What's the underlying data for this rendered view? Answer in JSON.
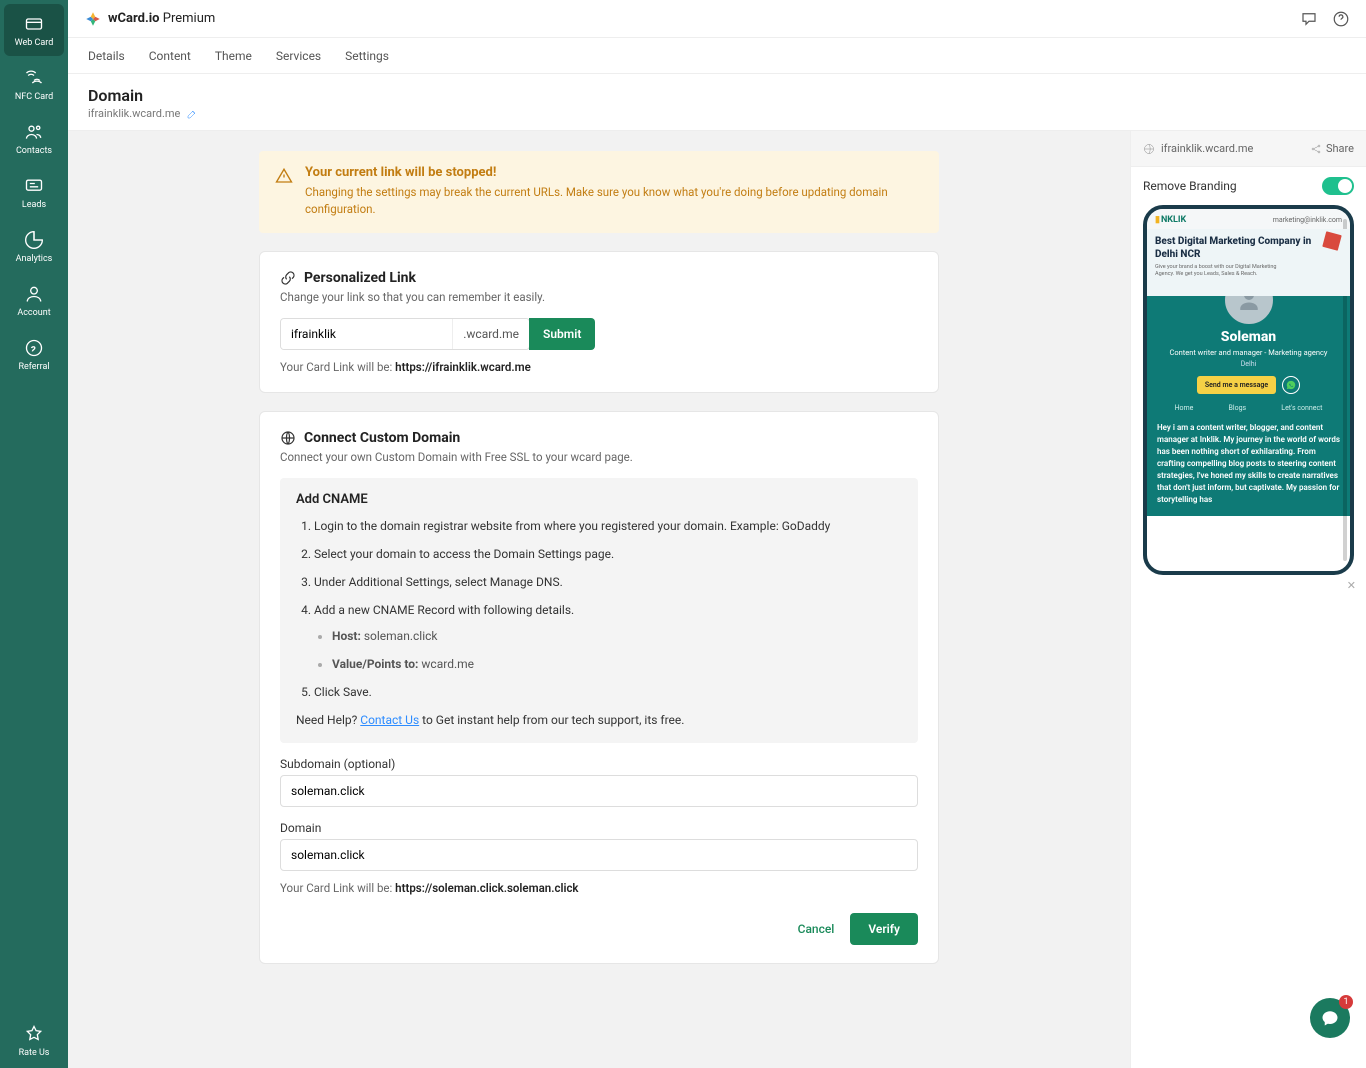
{
  "brand": {
    "name": "wCard.io",
    "tier": "Premium"
  },
  "sidebar": {
    "items": [
      {
        "label": "Web Card"
      },
      {
        "label": "NFC Card"
      },
      {
        "label": "Contacts"
      },
      {
        "label": "Leads"
      },
      {
        "label": "Analytics"
      },
      {
        "label": "Account"
      },
      {
        "label": "Referral"
      }
    ],
    "rate": "Rate Us"
  },
  "tabs": [
    "Details",
    "Content",
    "Theme",
    "Services",
    "Settings"
  ],
  "page": {
    "title": "Domain",
    "url": "ifrainklik.wcard.me"
  },
  "warning": {
    "title": "Your current link will be stopped!",
    "text": "Changing the settings may break the current URLs. Make sure you know what you're doing before updating domain configuration."
  },
  "personalized": {
    "heading": "Personalized Link",
    "sub": "Change your link so that you can remember it easily.",
    "value": "ifrainklik",
    "suffix": ".wcard.me",
    "submit": "Submit",
    "notePrefix": "Your Card Link will be: ",
    "noteLink": "https://ifrainklik.wcard.me"
  },
  "custom": {
    "heading": "Connect Custom Domain",
    "sub": "Connect your own Custom Domain with Free SSL to your wcard page.",
    "cnameTitle": "Add CNAME",
    "steps": [
      "Login to the domain registrar website from where you registered your domain. Example: GoDaddy",
      "Select your domain to access the Domain Settings page.",
      "Under Additional Settings, select Manage DNS.",
      "Add a new CNAME Record with following details."
    ],
    "hostLabel": "Host:",
    "hostValue": "soleman.click",
    "valueLabel": "Value/Points to:",
    "valueValue": "wcard.me",
    "step5": "Click Save.",
    "helpPrefix": "Need Help? ",
    "helpLink": "Contact Us",
    "helpSuffix": " to Get instant help from our tech support, its free.",
    "subdomainLabel": "Subdomain (optional)",
    "subdomainValue": "soleman.click",
    "domainLabel": "Domain",
    "domainValue": "soleman.click",
    "resultPrefix": "Your Card Link will be: ",
    "resultLink": "https://soleman.click.soleman.click",
    "cancel": "Cancel",
    "verify": "Verify"
  },
  "preview": {
    "url": "ifrainklik.wcard.me",
    "share": "Share",
    "brandingLabel": "Remove Branding",
    "logo": "NKLIK",
    "topr": "marketing@inklik.com",
    "heroTitle": "Best Digital Marketing Company in Delhi NCR",
    "heroSub": "Give your brand a boost with our Digital Marketing Agency. We get you Leads, Sales & Reach.",
    "name": "Soleman",
    "role": "Content writer and manager - Marketing agency",
    "loc": "Delhi",
    "cta": "Send me a message",
    "nav": [
      "Home",
      "Blogs",
      "Let's connect"
    ],
    "bio": "Hey i am a content writer, blogger, and content manager at Inklik. My journey in the world of words has been nothing short of exhilarating. From crafting compelling blog posts to steering content strategies, I've honed my skills to create narratives that don't just inform, but captivate. My passion for storytelling has"
  },
  "chatBadge": "1"
}
